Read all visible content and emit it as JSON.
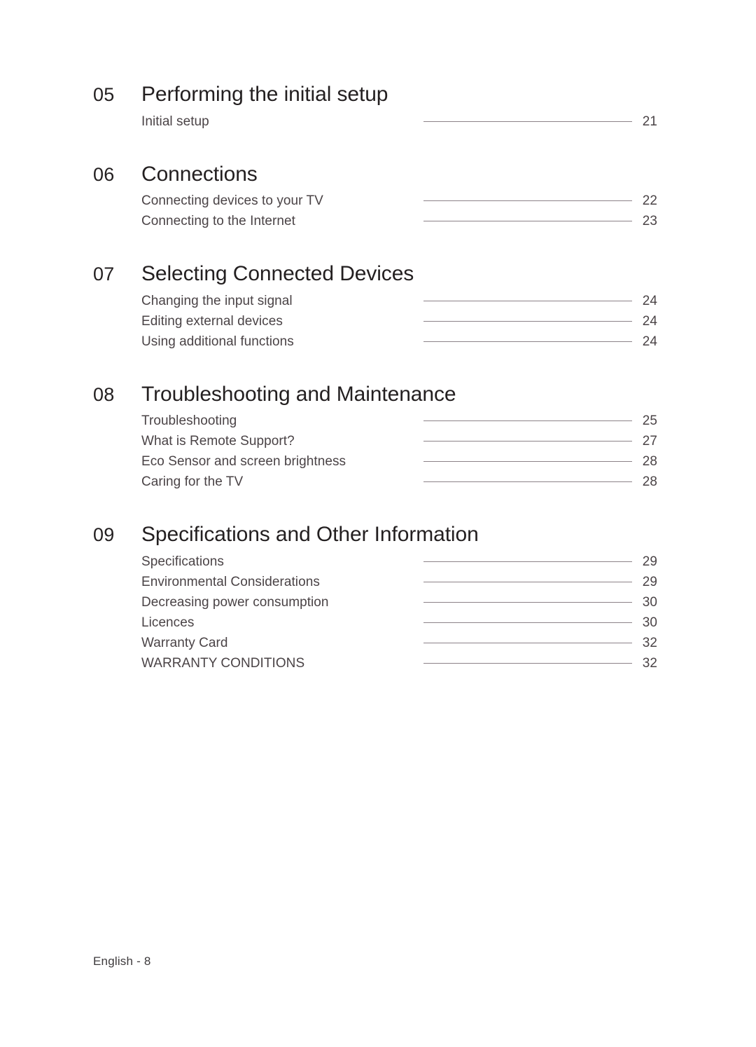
{
  "document": {
    "type": "table-of-contents",
    "footer_label": "English - 8"
  },
  "sections": [
    {
      "number": "05",
      "title": "Performing the initial setup",
      "entries": [
        {
          "label": "Initial setup",
          "page": "21"
        }
      ]
    },
    {
      "number": "06",
      "title": "Connections",
      "entries": [
        {
          "label": "Connecting devices to your TV",
          "page": "22"
        },
        {
          "label": "Connecting to the Internet",
          "page": "23"
        }
      ]
    },
    {
      "number": "07",
      "title": "Selecting Connected Devices",
      "entries": [
        {
          "label": "Changing the input signal",
          "page": "24"
        },
        {
          "label": "Editing external devices",
          "page": "24"
        },
        {
          "label": "Using additional functions",
          "page": "24"
        }
      ]
    },
    {
      "number": "08",
      "title": "Troubleshooting and Maintenance",
      "entries": [
        {
          "label": "Troubleshooting",
          "page": "25"
        },
        {
          "label": "What is Remote Support?",
          "page": "27"
        },
        {
          "label": "Eco Sensor and screen brightness",
          "page": "28"
        },
        {
          "label": "Caring for the TV",
          "page": "28"
        }
      ]
    },
    {
      "number": "09",
      "title": "Specifications and Other Information",
      "entries": [
        {
          "label": "Specifications",
          "page": "29"
        },
        {
          "label": "Environmental Considerations",
          "page": "29"
        },
        {
          "label": "Decreasing power consumption",
          "page": "30"
        },
        {
          "label": "Licences",
          "page": "30"
        },
        {
          "label": "Warranty Card",
          "page": "32"
        },
        {
          "label": "WARRANTY CONDITIONS",
          "page": "32"
        }
      ]
    }
  ]
}
